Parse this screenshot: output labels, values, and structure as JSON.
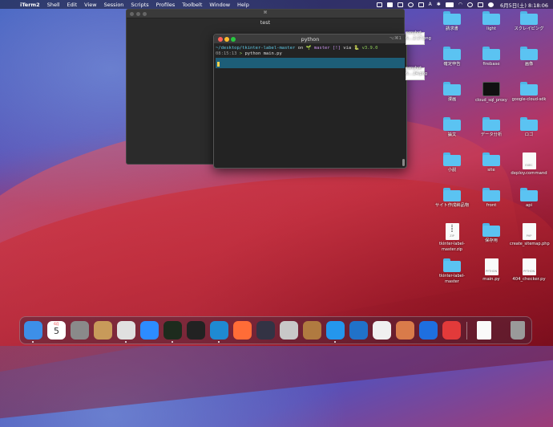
{
  "menubar": {
    "app": "iTerm2",
    "items": [
      "Shell",
      "Edit",
      "View",
      "Session",
      "Scripts",
      "Profiles",
      "Toolbelt",
      "Window",
      "Help"
    ],
    "input_method": "A",
    "clock": "6月5日(土) 8:18:06"
  },
  "back_window": {
    "tab_label": "⌘",
    "title": "test"
  },
  "front_window": {
    "title": "python",
    "shortcut": "⌥⌘1",
    "prompt_path": "~/desktop/tkinter-label-master",
    "prompt_on": "on",
    "branch_icon": "🌱",
    "branch": "master",
    "git_status": "[!]",
    "via": "via",
    "lang_icon": "🐍",
    "py_version": "v3.9.0",
    "time": "08:15:13",
    "arrow": ">",
    "command": "python main.py"
  },
  "screenshots": [
    {
      "line1": "eenshot",
      "line2": "6....2.17.png"
    },
    {
      "line1": "eenshot",
      "line2": "6....24.png"
    }
  ],
  "desktop_icons": [
    {
      "label": "請求書",
      "type": "folder"
    },
    {
      "label": "light",
      "type": "folder"
    },
    {
      "label": "スクレイピング",
      "type": "folder"
    },
    {
      "label": "確定申告",
      "type": "folder"
    },
    {
      "label": "firebase",
      "type": "folder"
    },
    {
      "label": "画像",
      "type": "folder"
    },
    {
      "label": "漫画",
      "type": "folder"
    },
    {
      "label": "cloud_sql_proxy",
      "type": "terminal"
    },
    {
      "label": "google-cloud-sdk",
      "type": "folder"
    },
    {
      "label": "論文",
      "type": "folder"
    },
    {
      "label": "データ分析",
      "type": "folder"
    },
    {
      "label": "ロゴ",
      "type": "folder"
    },
    {
      "label": "小説",
      "type": "folder"
    },
    {
      "label": "site",
      "type": "folder"
    },
    {
      "label": "deploy.command",
      "type": "doc",
      "filetype": "EXEC"
    },
    {
      "label": "サイト作成納品物",
      "type": "folder"
    },
    {
      "label": "front",
      "type": "folder"
    },
    {
      "label": "api",
      "type": "folder"
    },
    {
      "label": "tkinter-label-master.zip",
      "type": "zip",
      "filetype": "ZIP"
    },
    {
      "label": "保存用",
      "type": "folder"
    },
    {
      "label": "create_sitemap.php",
      "type": "doc",
      "filetype": "PHP"
    },
    {
      "label": "tkinter-label-master",
      "type": "folder"
    },
    {
      "label": "main.py",
      "type": "doc",
      "filetype": "PYTHON"
    },
    {
      "label": "404_checker.py",
      "type": "doc",
      "filetype": "PYTHON"
    }
  ],
  "dock": {
    "apps": [
      {
        "name": "Finder",
        "color": "#3d8fe8",
        "running": true
      },
      {
        "name": "Calendar",
        "color": "#ffffff",
        "running": false,
        "month": "6月",
        "day": "5"
      },
      {
        "name": "System Preferences",
        "color": "#8a8a8a",
        "running": false
      },
      {
        "name": "Contacts",
        "color": "#c89a5a",
        "running": false
      },
      {
        "name": "Chrome",
        "color": "#e0e0e0",
        "running": true
      },
      {
        "name": "Zoom",
        "color": "#2d8cff",
        "running": false
      },
      {
        "name": "iTerm2",
        "color": "#1d2b1d",
        "running": true
      },
      {
        "name": "Terminal",
        "color": "#222222",
        "running": false
      },
      {
        "name": "VS Code",
        "color": "#1f8ad2",
        "running": true
      },
      {
        "name": "Postman",
        "color": "#ff6c37",
        "running": false
      },
      {
        "name": "QuickTime",
        "color": "#333344",
        "running": false
      },
      {
        "name": "Sequel Pro",
        "color": "#c8c8c8",
        "running": false
      },
      {
        "name": "Archive Utility",
        "color": "#b07a40",
        "running": false
      },
      {
        "name": "Docker",
        "color": "#2496ed",
        "running": true
      },
      {
        "name": "Sourcetree",
        "color": "#2172c9",
        "running": false
      },
      {
        "name": "App",
        "color": "#f0f0f0",
        "running": false
      },
      {
        "name": "Preview",
        "color": "#d97b4a",
        "running": false
      },
      {
        "name": "Infinity",
        "color": "#1e6fe0",
        "running": false
      },
      {
        "name": "Clock",
        "color": "#e23a3a",
        "running": false
      }
    ],
    "stack": {
      "name": "Document",
      "color": "#fafafa"
    },
    "trash": {
      "name": "Trash",
      "color": "#9a9a9a"
    }
  }
}
